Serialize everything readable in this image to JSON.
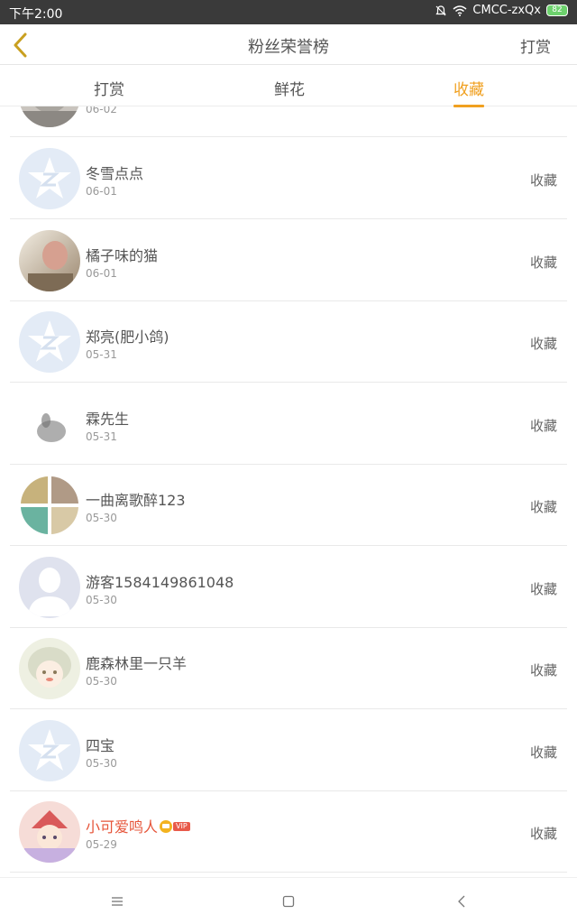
{
  "status_bar": {
    "time": "下午2:00",
    "carrier": "CMCC-zxQx",
    "battery": "82",
    "icons": [
      "notifications-off-icon",
      "wifi-icon",
      "battery-icon"
    ]
  },
  "header": {
    "title": "粉丝荣誉榜",
    "action_label": "打赏",
    "back_icon": "chevron-left-icon",
    "accent_color": "#f0a020"
  },
  "tabs": [
    {
      "label": "打赏",
      "active": false
    },
    {
      "label": "鲜花",
      "active": false
    },
    {
      "label": "收藏",
      "active": true
    }
  ],
  "list": {
    "partial_first_date": "06-02",
    "items": [
      {
        "name": "冬雪点点",
        "date": "06-01",
        "action": "收藏",
        "avatar": "qq-default-avatar"
      },
      {
        "name": "橘子味的猫",
        "date": "06-01",
        "action": "收藏",
        "avatar": "photo-avatar"
      },
      {
        "name": "郑亮(肥小鸽)",
        "date": "05-31",
        "action": "收藏",
        "avatar": "qq-default-avatar"
      },
      {
        "name": "霖先生",
        "date": "05-31",
        "action": "收藏",
        "avatar": "ink-avatar"
      },
      {
        "name": "一曲离歌醉123",
        "date": "05-30",
        "action": "收藏",
        "avatar": "collage-avatar"
      },
      {
        "name": "游客1584149861048",
        "date": "05-30",
        "action": "收藏",
        "avatar": "guest-silhouette-avatar"
      },
      {
        "name": "鹿森林里一只羊",
        "date": "05-30",
        "action": "收藏",
        "avatar": "anime-avatar"
      },
      {
        "name": "四宝",
        "date": "05-30",
        "action": "收藏",
        "avatar": "qq-default-avatar"
      },
      {
        "name": "小可爱鸣人",
        "date": "05-29",
        "action": "收藏",
        "avatar": "cartoon-avatar",
        "vip": true,
        "vip_label": "VIP"
      }
    ]
  },
  "bottom_nav": {
    "icons": [
      "menu-icon",
      "home-square-icon",
      "back-triangle-icon"
    ]
  }
}
